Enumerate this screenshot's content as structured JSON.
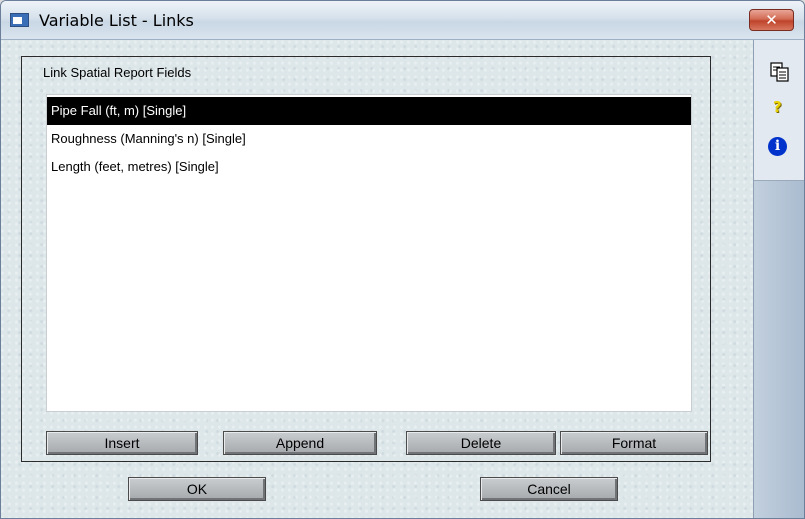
{
  "window": {
    "title": "Variable List - Links",
    "close_label": "✕"
  },
  "group": {
    "label": "Link Spatial Report Fields"
  },
  "list": {
    "items": [
      {
        "label": "Pipe Fall (ft, m) [Single]",
        "selected": true
      },
      {
        "label": "Roughness (Manning's n) [Single]",
        "selected": false
      },
      {
        "label": "Length (feet, metres) [Single]",
        "selected": false
      }
    ]
  },
  "buttons": {
    "insert": "Insert",
    "append": "Append",
    "delete": "Delete",
    "format": "Format",
    "ok": "OK",
    "cancel": "Cancel"
  },
  "sidebar": {
    "icons": [
      "copy-icon",
      "help-icon",
      "info-icon"
    ],
    "help_glyph": "?",
    "info_glyph": "i"
  },
  "colors": {
    "selection": "#000000",
    "help": "#e8d000",
    "info": "#0033cc",
    "close": "#c0432b"
  }
}
